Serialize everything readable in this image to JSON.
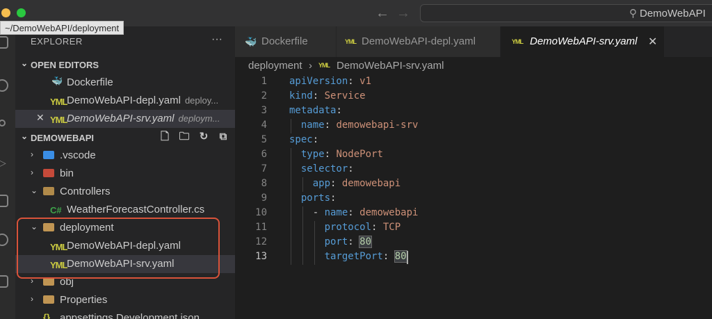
{
  "titlebar": {
    "search_text": "DemoWebAPI"
  },
  "tooltip": "~/DemoWebAPI/deployment",
  "sidebar": {
    "title": "EXPLORER",
    "more": "···",
    "open_editors": {
      "label": "OPEN EDITORS",
      "items": [
        {
          "name": "Dockerfile",
          "desc": ""
        },
        {
          "name": "DemoWebAPI-depl.yaml",
          "desc": "deploy..."
        },
        {
          "name": "DemoWebAPI-srv.yaml",
          "desc": "deploym..."
        }
      ]
    },
    "workspace": {
      "label": "DEMOWEBAPI",
      "items": [
        {
          "name": ".vscode"
        },
        {
          "name": "bin"
        },
        {
          "name": "Controllers"
        },
        {
          "name": "WeatherForecastController.cs"
        },
        {
          "name": "deployment"
        },
        {
          "name": "DemoWebAPI-depl.yaml"
        },
        {
          "name": "DemoWebAPI-srv.yaml"
        },
        {
          "name": "obj"
        },
        {
          "name": "Properties"
        },
        {
          "name": "appsettings.Development.json"
        }
      ]
    }
  },
  "tabs": [
    {
      "label": "Dockerfile"
    },
    {
      "label": "DemoWebAPI-depl.yaml"
    },
    {
      "label": "DemoWebAPI-srv.yaml"
    }
  ],
  "breadcrumb": {
    "folder": "deployment",
    "file": "DemoWebAPI-srv.yaml"
  },
  "editor": {
    "lines": [
      {
        "n": "1"
      },
      {
        "n": "2"
      },
      {
        "n": "3"
      },
      {
        "n": "4"
      },
      {
        "n": "5"
      },
      {
        "n": "6"
      },
      {
        "n": "7"
      },
      {
        "n": "8"
      },
      {
        "n": "9"
      },
      {
        "n": "10"
      },
      {
        "n": "11"
      },
      {
        "n": "12"
      },
      {
        "n": "13"
      }
    ],
    "tokens": {
      "l1k": "apiVersion",
      "l1v": "v1",
      "l2k": "kind",
      "l2v": "Service",
      "l3k": "metadata",
      "l4k": "name",
      "l4v": "demowebapi-srv",
      "l5k": "spec",
      "l6k": "type",
      "l6v": "NodePort",
      "l7k": "selector",
      "l8k": "app",
      "l8v": "demowebapi",
      "l9k": "ports",
      "l10k": "name",
      "l10v": "demowebapi",
      "l11k": "protocol",
      "l11v": "TCP",
      "l12k": "port",
      "l12v": "80",
      "l13k": "targetPort",
      "l13v": "80"
    }
  },
  "colors": {
    "accent_highlight": "#d9533a",
    "yaml_key": "#569cd6",
    "yaml_value": "#ce9178",
    "yaml_number": "#b5cea8"
  }
}
